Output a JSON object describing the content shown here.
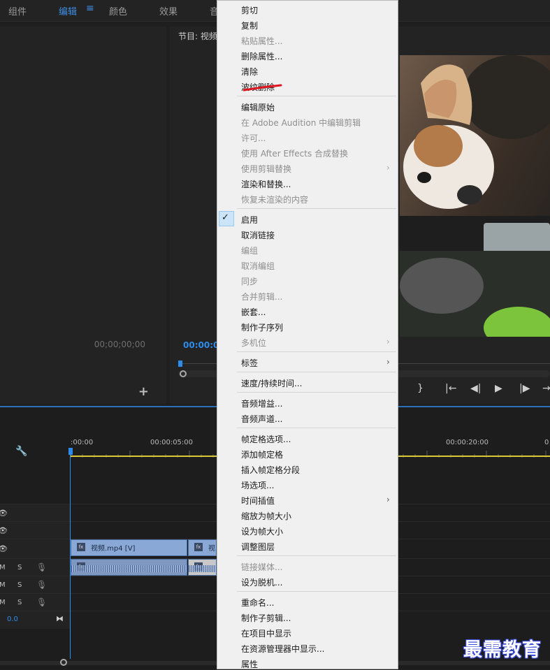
{
  "workspace_tabs": [
    {
      "label": "组件",
      "active": false
    },
    {
      "label": "编辑",
      "active": true
    },
    {
      "label": "颜色",
      "active": false
    },
    {
      "label": "效果",
      "active": false
    },
    {
      "label": "音",
      "active": false
    }
  ],
  "workspace_menu_icon": "hamburger-icon",
  "source_panel": {
    "timecode": "00;00;00;00",
    "add_label": "+"
  },
  "program_panel": {
    "title": "节目: 视频",
    "timecode": "00:00:0"
  },
  "timeline": {
    "times": [
      ":00:00",
      "00:00:05:00",
      "00:00:20:00",
      "0"
    ],
    "clips": {
      "video1": "视频.mp4 [V]",
      "video2": "视"
    },
    "tracks": {
      "m_label": "M",
      "s_label": "S",
      "audio_level": "0.0"
    }
  },
  "context_menu": {
    "items": [
      {
        "label": "剪切",
        "disabled": false
      },
      {
        "label": "复制",
        "disabled": false
      },
      {
        "label": "粘贴属性...",
        "disabled": true
      },
      {
        "label": "删除属性...",
        "disabled": false
      },
      {
        "label": "清除",
        "disabled": false
      },
      {
        "label": "波纹删除",
        "disabled": false
      },
      {
        "label": "编辑原始",
        "disabled": false
      },
      {
        "label": "在 Adobe Audition 中编辑剪辑",
        "disabled": true
      },
      {
        "label": "许可...",
        "disabled": true
      },
      {
        "label": "使用 After Effects 合成替换",
        "disabled": true
      },
      {
        "label": "使用剪辑替换",
        "disabled": true
      },
      {
        "label": "渲染和替换...",
        "disabled": false
      },
      {
        "label": "恢复未渲染的内容",
        "disabled": true
      },
      {
        "label": "启用",
        "disabled": false,
        "checked": true
      },
      {
        "label": "取消链接",
        "disabled": false
      },
      {
        "label": "编组",
        "disabled": true
      },
      {
        "label": "取消编组",
        "disabled": true
      },
      {
        "label": "同步",
        "disabled": true
      },
      {
        "label": "合并剪辑...",
        "disabled": true
      },
      {
        "label": "嵌套...",
        "disabled": false
      },
      {
        "label": "制作子序列",
        "disabled": false
      },
      {
        "label": "多机位",
        "disabled": true
      },
      {
        "label": "标签",
        "disabled": false
      },
      {
        "label": "速度/持续时间...",
        "disabled": false
      },
      {
        "label": "音频增益...",
        "disabled": false
      },
      {
        "label": "音频声道...",
        "disabled": false
      },
      {
        "label": "帧定格选项...",
        "disabled": false
      },
      {
        "label": "添加帧定格",
        "disabled": false
      },
      {
        "label": "插入帧定格分段",
        "disabled": false
      },
      {
        "label": "场选项...",
        "disabled": false
      },
      {
        "label": "时间插值",
        "disabled": false
      },
      {
        "label": "缩放为帧大小",
        "disabled": false
      },
      {
        "label": "设为帧大小",
        "disabled": false
      },
      {
        "label": "调整图层",
        "disabled": false
      },
      {
        "label": "链接媒体...",
        "disabled": true
      },
      {
        "label": "设为脱机...",
        "disabled": false
      },
      {
        "label": "重命名...",
        "disabled": false
      },
      {
        "label": "制作子剪辑...",
        "disabled": false
      },
      {
        "label": "在项目中显示",
        "disabled": false
      },
      {
        "label": "在资源管理器中显示...",
        "disabled": false
      },
      {
        "label": "属性",
        "disabled": false
      }
    ],
    "submenu_arrow": "›",
    "check_glyph": "✓"
  },
  "watermark": "最需教育",
  "colors": {
    "accent": "#2d8ceb",
    "menu_bg": "#f0f0f0",
    "highlight_stroke": "#e0141e"
  }
}
